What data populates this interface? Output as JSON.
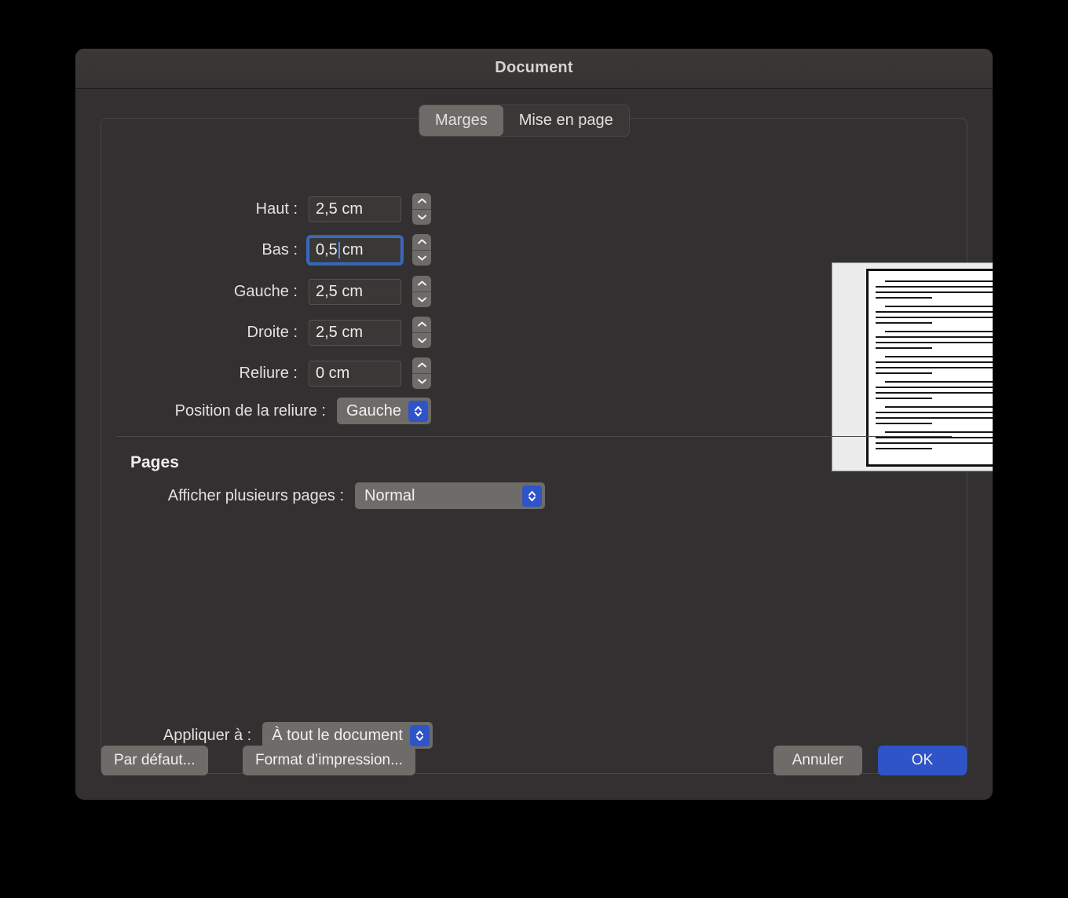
{
  "window": {
    "title": "Document"
  },
  "tabs": [
    {
      "label": "Marges",
      "selected": true
    },
    {
      "label": "Mise en page",
      "selected": false
    }
  ],
  "margins": {
    "top": {
      "label": "Haut :",
      "value": "2,5 cm",
      "focused": false
    },
    "bottom": {
      "label": "Bas :",
      "value": "0,5 ",
      "suffix": "cm",
      "focused": true
    },
    "left": {
      "label": "Gauche :",
      "value": "2,5 cm",
      "focused": false
    },
    "right": {
      "label": "Droite :",
      "value": "2,5 cm",
      "focused": false
    },
    "gutter": {
      "label": "Reliure :",
      "value": "0 cm",
      "focused": false
    },
    "gutter_position": {
      "label": "Position de la reliure :",
      "value": "Gauche"
    }
  },
  "pages": {
    "heading": "Pages",
    "multiple_pages": {
      "label": "Afficher plusieurs pages :",
      "value": "Normal"
    }
  },
  "apply": {
    "label": "Appliquer à :",
    "value": "À tout le document"
  },
  "footer": {
    "defaults": "Par défaut...",
    "page_setup": "Format d’impression...",
    "cancel": "Annuler",
    "ok": "OK"
  },
  "preview": {
    "paragraph_count": 7,
    "lines_per_paragraph": 4
  },
  "colors": {
    "accent": "#2f54c8",
    "window_bg": "#323030",
    "control_gray": "#6e6c69",
    "field_bg": "#3a3836",
    "focus_ring": "#3c6fd0",
    "text": "#e4e2e0",
    "preview_bg": "#ececec"
  }
}
